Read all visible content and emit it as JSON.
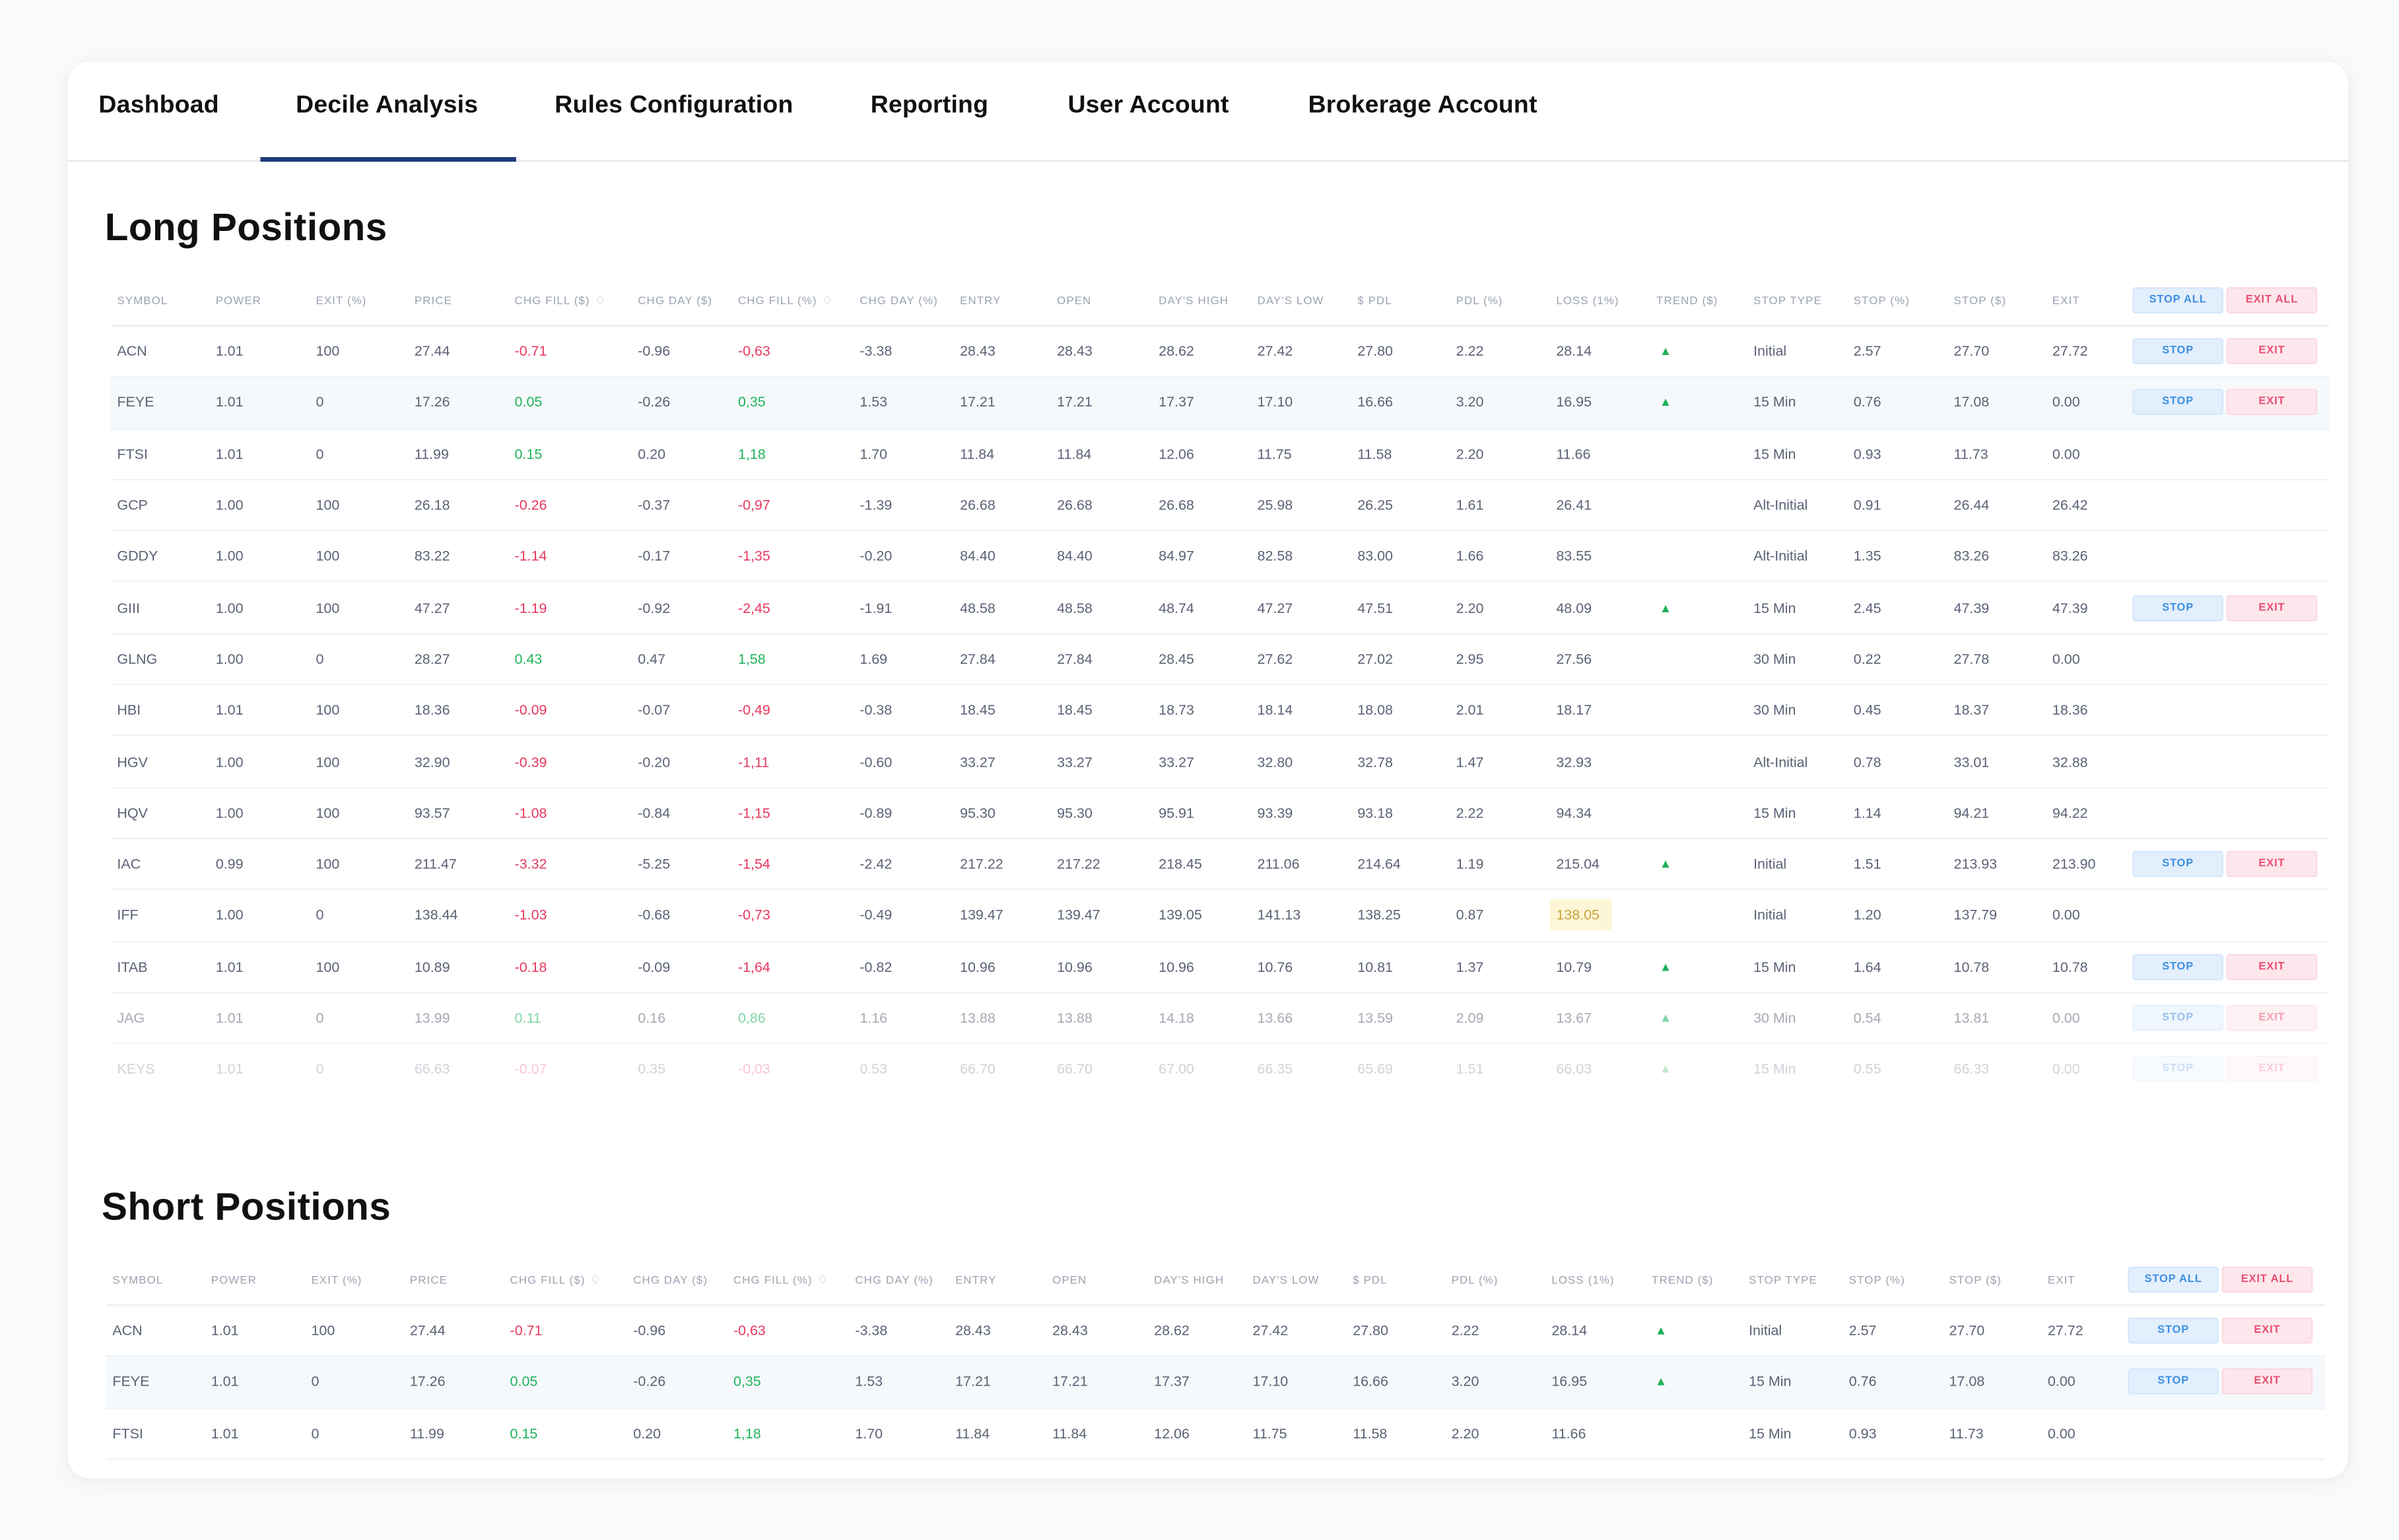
{
  "nav": {
    "tabs": [
      {
        "label": "Dashboad",
        "active": false
      },
      {
        "label": "Decile Analysis",
        "active": true
      },
      {
        "label": "Rules Configuration",
        "active": false
      },
      {
        "label": "Reporting",
        "active": false
      },
      {
        "label": "User Account",
        "active": false
      },
      {
        "label": "Brokerage Account",
        "active": false
      }
    ]
  },
  "colors": {
    "accent": "#1f3a78",
    "negative": "#e8385f",
    "positive": "#1fb25a",
    "stop_button": "#3d8fe0",
    "exit_button": "#ea4d71",
    "highlight": "#fdf6d6"
  },
  "columns": [
    "SYMBOL",
    "POWER",
    "EXIT (%)",
    "PRICE",
    "CHG FILL ($)",
    "CHG DAY ($)",
    "CHG FILL (%)",
    "CHG DAY (%)",
    "ENTRY",
    "OPEN",
    "DAY'S HIGH",
    "DAY'S LOW",
    "$ PDL",
    "PDL (%)",
    "LOSS (1%)",
    "TREND ($)",
    "STOP TYPE",
    "STOP (%)",
    "STOP ($)",
    "EXIT"
  ],
  "sortable_columns": [
    "CHG FILL ($)",
    "CHG FILL (%)"
  ],
  "actions": {
    "stop_all": "STOP ALL",
    "exit_all": "EXIT ALL",
    "stop": "STOP",
    "exit": "EXIT"
  },
  "long_positions": {
    "title": "Long Positions",
    "rows": [
      {
        "symbol": "ACN",
        "power": "1.01",
        "exit_pct": "100",
        "price": "27.44",
        "chg_fill_usd": "-0.71",
        "chg_day_usd": "-0.96",
        "chg_fill_pct": "-0,63",
        "chg_day_pct": "-3.38",
        "entry": "28.43",
        "open": "28.43",
        "days_high": "28.62",
        "days_low": "27.42",
        "pdl_usd": "27.80",
        "pdl_pct": "2.22",
        "loss": "28.14",
        "trend": "up",
        "stop_type": "Initial",
        "stop_pct": "2.57",
        "stop_usd": "27.70",
        "exit": "27.72",
        "actions": true
      },
      {
        "symbol": "FEYE",
        "power": "1.01",
        "exit_pct": "0",
        "price": "17.26",
        "chg_fill_usd": "0.05",
        "chg_day_usd": "-0.26",
        "chg_fill_pct": "0,35",
        "chg_day_pct": "1.53",
        "entry": "17.21",
        "open": "17.21",
        "days_high": "17.37",
        "days_low": "17.10",
        "pdl_usd": "16.66",
        "pdl_pct": "3.20",
        "loss": "16.95",
        "trend": "up",
        "stop_type": "15 Min",
        "stop_pct": "0.76",
        "stop_usd": "17.08",
        "exit": "0.00",
        "actions": true,
        "selected": true
      },
      {
        "symbol": "FTSI",
        "power": "1.01",
        "exit_pct": "0",
        "price": "11.99",
        "chg_fill_usd": "0.15",
        "chg_day_usd": "0.20",
        "chg_fill_pct": "1,18",
        "chg_day_pct": "1.70",
        "entry": "11.84",
        "open": "11.84",
        "days_high": "12.06",
        "days_low": "11.75",
        "pdl_usd": "11.58",
        "pdl_pct": "2.20",
        "loss": "11.66",
        "trend": "",
        "stop_type": "15 Min",
        "stop_pct": "0.93",
        "stop_usd": "11.73",
        "exit": "0.00",
        "actions": false
      },
      {
        "symbol": "GCP",
        "power": "1.00",
        "exit_pct": "100",
        "price": "26.18",
        "chg_fill_usd": "-0.26",
        "chg_day_usd": "-0.37",
        "chg_fill_pct": "-0,97",
        "chg_day_pct": "-1.39",
        "entry": "26.68",
        "open": "26.68",
        "days_high": "26.68",
        "days_low": "25.98",
        "pdl_usd": "26.25",
        "pdl_pct": "1.61",
        "loss": "26.41",
        "trend": "",
        "stop_type": "Alt-Initial",
        "stop_pct": "0.91",
        "stop_usd": "26.44",
        "exit": "26.42",
        "actions": false
      },
      {
        "symbol": "GDDY",
        "power": "1.00",
        "exit_pct": "100",
        "price": "83.22",
        "chg_fill_usd": "-1.14",
        "chg_day_usd": "-0.17",
        "chg_fill_pct": "-1,35",
        "chg_day_pct": "-0.20",
        "entry": "84.40",
        "open": "84.40",
        "days_high": "84.97",
        "days_low": "82.58",
        "pdl_usd": "83.00",
        "pdl_pct": "1.66",
        "loss": "83.55",
        "trend": "",
        "stop_type": "Alt-Initial",
        "stop_pct": "1.35",
        "stop_usd": "83.26",
        "exit": "83.26",
        "actions": false
      },
      {
        "symbol": "GIII",
        "power": "1.00",
        "exit_pct": "100",
        "price": "47.27",
        "chg_fill_usd": "-1.19",
        "chg_day_usd": "-0.92",
        "chg_fill_pct": "-2,45",
        "chg_day_pct": "-1.91",
        "entry": "48.58",
        "open": "48.58",
        "days_high": "48.74",
        "days_low": "47.27",
        "pdl_usd": "47.51",
        "pdl_pct": "2.20",
        "loss": "48.09",
        "trend": "up",
        "stop_type": "15 Min",
        "stop_pct": "2.45",
        "stop_usd": "47.39",
        "exit": "47.39",
        "actions": true
      },
      {
        "symbol": "GLNG",
        "power": "1.00",
        "exit_pct": "0",
        "price": "28.27",
        "chg_fill_usd": "0.43",
        "chg_day_usd": "0.47",
        "chg_fill_pct": "1,58",
        "chg_day_pct": "1.69",
        "entry": "27.84",
        "open": "27.84",
        "days_high": "28.45",
        "days_low": "27.62",
        "pdl_usd": "27.02",
        "pdl_pct": "2.95",
        "loss": "27.56",
        "trend": "",
        "stop_type": "30 Min",
        "stop_pct": "0.22",
        "stop_usd": "27.78",
        "exit": "0.00",
        "actions": false
      },
      {
        "symbol": "HBI",
        "power": "1.01",
        "exit_pct": "100",
        "price": "18.36",
        "chg_fill_usd": "-0.09",
        "chg_day_usd": "-0.07",
        "chg_fill_pct": "-0,49",
        "chg_day_pct": "-0.38",
        "entry": "18.45",
        "open": "18.45",
        "days_high": "18.73",
        "days_low": "18.14",
        "pdl_usd": "18.08",
        "pdl_pct": "2.01",
        "loss": "18.17",
        "trend": "",
        "stop_type": "30 Min",
        "stop_pct": "0.45",
        "stop_usd": "18.37",
        "exit": "18.36",
        "actions": false
      },
      {
        "symbol": "HGV",
        "power": "1.00",
        "exit_pct": "100",
        "price": "32.90",
        "chg_fill_usd": "-0.39",
        "chg_day_usd": "-0.20",
        "chg_fill_pct": "-1,11",
        "chg_day_pct": "-0.60",
        "entry": "33.27",
        "open": "33.27",
        "days_high": "33.27",
        "days_low": "32.80",
        "pdl_usd": "32.78",
        "pdl_pct": "1.47",
        "loss": "32.93",
        "trend": "",
        "stop_type": "Alt-Initial",
        "stop_pct": "0.78",
        "stop_usd": "33.01",
        "exit": "32.88",
        "actions": false
      },
      {
        "symbol": "HQV",
        "power": "1.00",
        "exit_pct": "100",
        "price": "93.57",
        "chg_fill_usd": "-1.08",
        "chg_day_usd": "-0.84",
        "chg_fill_pct": "-1,15",
        "chg_day_pct": "-0.89",
        "entry": "95.30",
        "open": "95.30",
        "days_high": "95.91",
        "days_low": "93.39",
        "pdl_usd": "93.18",
        "pdl_pct": "2.22",
        "loss": "94.34",
        "trend": "",
        "stop_type": "15 Min",
        "stop_pct": "1.14",
        "stop_usd": "94.21",
        "exit": "94.22",
        "actions": false
      },
      {
        "symbol": "IAC",
        "power": "0.99",
        "exit_pct": "100",
        "price": "211.47",
        "chg_fill_usd": "-3.32",
        "chg_day_usd": "-5.25",
        "chg_fill_pct": "-1,54",
        "chg_day_pct": "-2.42",
        "entry": "217.22",
        "open": "217.22",
        "days_high": "218.45",
        "days_low": "211.06",
        "pdl_usd": "214.64",
        "pdl_pct": "1.19",
        "loss": "215.04",
        "trend": "up",
        "stop_type": "Initial",
        "stop_pct": "1.51",
        "stop_usd": "213.93",
        "exit": "213.90",
        "actions": true
      },
      {
        "symbol": "IFF",
        "power": "1.00",
        "exit_pct": "0",
        "price": "138.44",
        "chg_fill_usd": "-1.03",
        "chg_day_usd": "-0.68",
        "chg_fill_pct": "-0,73",
        "chg_day_pct": "-0.49",
        "entry": "139.47",
        "open": "139.47",
        "days_high": "139.05",
        "days_low": "141.13",
        "pdl_usd": "138.25",
        "pdl_pct": "0.87",
        "loss": "138.05",
        "loss_highlight": true,
        "trend": "",
        "stop_type": "Initial",
        "stop_pct": "1.20",
        "stop_usd": "137.79",
        "exit": "0.00",
        "actions": false
      },
      {
        "symbol": "ITAB",
        "power": "1.01",
        "exit_pct": "100",
        "price": "10.89",
        "chg_fill_usd": "-0.18",
        "chg_day_usd": "-0.09",
        "chg_fill_pct": "-1,64",
        "chg_day_pct": "-0.82",
        "entry": "10.96",
        "open": "10.96",
        "days_high": "10.96",
        "days_low": "10.76",
        "pdl_usd": "10.81",
        "pdl_pct": "1.37",
        "loss": "10.79",
        "trend": "up",
        "stop_type": "15 Min",
        "stop_pct": "1.64",
        "stop_usd": "10.78",
        "exit": "10.78",
        "actions": true
      },
      {
        "symbol": "JAG",
        "power": "1.01",
        "exit_pct": "0",
        "price": "13.99",
        "chg_fill_usd": "0.11",
        "chg_day_usd": "0.16",
        "chg_fill_pct": "0,86",
        "chg_day_pct": "1.16",
        "entry": "13.88",
        "open": "13.88",
        "days_high": "14.18",
        "days_low": "13.66",
        "pdl_usd": "13.59",
        "pdl_pct": "2.09",
        "loss": "13.67",
        "trend": "up",
        "stop_type": "30 Min",
        "stop_pct": "0.54",
        "stop_usd": "13.81",
        "exit": "0.00",
        "actions": true,
        "fade": 1
      },
      {
        "symbol": "KEYS",
        "power": "1.01",
        "exit_pct": "0",
        "price": "66.63",
        "chg_fill_usd": "-0.07",
        "chg_day_usd": "0.35",
        "chg_fill_pct": "-0,03",
        "chg_day_pct": "0.53",
        "entry": "66.70",
        "open": "66.70",
        "days_high": "67.00",
        "days_low": "66.35",
        "pdl_usd": "65.69",
        "pdl_pct": "1.51",
        "loss": "66.03",
        "trend": "up",
        "stop_type": "15 Min",
        "stop_pct": "0.55",
        "stop_usd": "66.33",
        "exit": "0.00",
        "actions": true,
        "fade": 2
      }
    ]
  },
  "short_positions": {
    "title": "Short Positions",
    "rows": [
      {
        "symbol": "ACN",
        "power": "1.01",
        "exit_pct": "100",
        "price": "27.44",
        "chg_fill_usd": "-0.71",
        "chg_day_usd": "-0.96",
        "chg_fill_pct": "-0,63",
        "chg_day_pct": "-3.38",
        "entry": "28.43",
        "open": "28.43",
        "days_high": "28.62",
        "days_low": "27.42",
        "pdl_usd": "27.80",
        "pdl_pct": "2.22",
        "loss": "28.14",
        "trend": "up",
        "stop_type": "Initial",
        "stop_pct": "2.57",
        "stop_usd": "27.70",
        "exit": "27.72",
        "actions": true
      },
      {
        "symbol": "FEYE",
        "power": "1.01",
        "exit_pct": "0",
        "price": "17.26",
        "chg_fill_usd": "0.05",
        "chg_day_usd": "-0.26",
        "chg_fill_pct": "0,35",
        "chg_day_pct": "1.53",
        "entry": "17.21",
        "open": "17.21",
        "days_high": "17.37",
        "days_low": "17.10",
        "pdl_usd": "16.66",
        "pdl_pct": "3.20",
        "loss": "16.95",
        "trend": "up",
        "stop_type": "15 Min",
        "stop_pct": "0.76",
        "stop_usd": "17.08",
        "exit": "0.00",
        "actions": true,
        "selected": true
      },
      {
        "symbol": "FTSI",
        "power": "1.01",
        "exit_pct": "0",
        "price": "11.99",
        "chg_fill_usd": "0.15",
        "chg_day_usd": "0.20",
        "chg_fill_pct": "1,18",
        "chg_day_pct": "1.70",
        "entry": "11.84",
        "open": "11.84",
        "days_high": "12.06",
        "days_low": "11.75",
        "pdl_usd": "11.58",
        "pdl_pct": "2.20",
        "loss": "11.66",
        "trend": "",
        "stop_type": "15 Min",
        "stop_pct": "0.93",
        "stop_usd": "11.73",
        "exit": "0.00",
        "actions": false
      }
    ]
  }
}
